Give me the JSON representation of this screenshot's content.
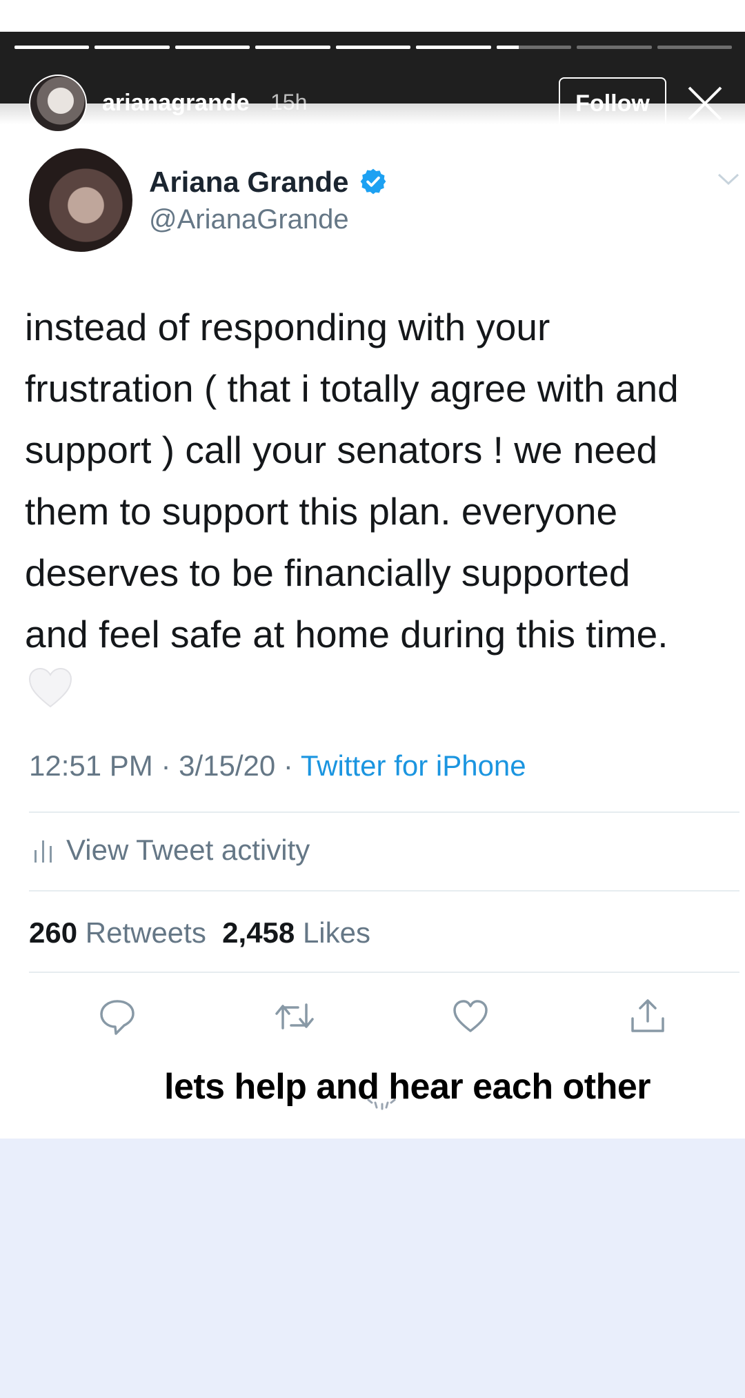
{
  "story": {
    "username": "arianagrande",
    "time": "15h",
    "follow_label": "Follow",
    "progress": [
      1,
      1,
      1,
      1,
      1,
      1,
      0.3,
      0,
      0
    ]
  },
  "tweet": {
    "name": "Ariana Grande",
    "handle": "@ArianaGrande",
    "text": "instead of responding with your\nfrustration ( that i totally agree with and\nsupport ) call your senators ! we need\nthem to support this plan. everyone\ndeserves to be financially supported\nand feel safe at home during this time.",
    "time": "12:51 PM",
    "date": "3/15/20",
    "source": "Twitter for iPhone",
    "activity_label": "View Tweet activity",
    "retweets_count": "260",
    "retweets_label": "Retweets",
    "likes_count": "2,458",
    "likes_label": "Likes"
  },
  "caption": "lets help and hear each other",
  "colors": {
    "header_bg": "#1f1f1f",
    "twitter_blue": "#1b95e0",
    "muted": "#657786",
    "page_bg": "#e9eefb"
  },
  "icons": [
    "close-icon",
    "verified-icon",
    "caret-down-icon",
    "white-heart-icon",
    "bar-chart-icon",
    "reply-icon",
    "retweet-icon",
    "like-icon",
    "share-icon",
    "loading-spinner-icon"
  ]
}
